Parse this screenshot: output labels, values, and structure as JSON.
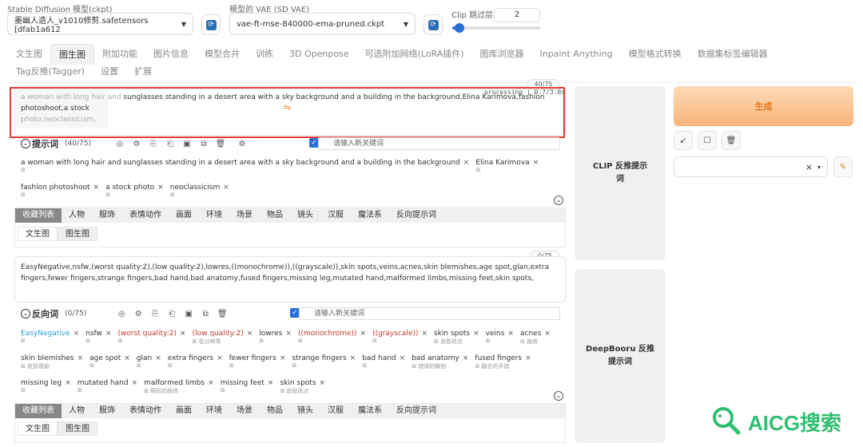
{
  "header": {
    "model_label": "Stable Diffusion 模型(ckpt)",
    "model_value": "墨幽人造人_v1010修剪.safetensors [dfab1a612",
    "vae_label": "模型的 VAE (SD VAE)",
    "vae_value": "vae-ft-mse-840000-ema-pruned.ckpt",
    "clip_label": "Clip 跳过层",
    "clip_value": "2",
    "clip_slider_fraction": 0.08
  },
  "tabs": [
    "文生图",
    "图生图",
    "附加功能",
    "图片信息",
    "模型合并",
    "训练",
    "3D Openpose",
    "可选附加网络(LoRA插件)",
    "图库浏览器",
    "Inpaint Anything",
    "模型格式转换",
    "数据集标签编辑器"
  ],
  "tabs2": [
    "Tag反推(Tagger)",
    "设置",
    "扩展"
  ],
  "active_tab": "图生图",
  "prompt": {
    "counter": "40/75",
    "processing": "processing | 0.7/3.8s",
    "text_left": "a woman with long hair and",
    "text_main": " sunglasses standing in a desert area with a sky background and a building in the background,Elina Karimova,fashion photoshoot,a stock",
    "text_line2": "photo,neoclassicism,",
    "title": "提示词",
    "count": "(40/75)",
    "keyword_placeholder": "请输入新关键词",
    "tags": [
      {
        "t": "a woman with long hair and sunglasses standing in a desert area with a sky background and a building in the background",
        "s": ""
      },
      {
        "t": "Elina Karimova",
        "s": ""
      },
      {
        "t": "fashion photoshoot",
        "s": ""
      },
      {
        "t": "a stock photo",
        "s": ""
      },
      {
        "t": "neoclassicism",
        "s": ""
      }
    ]
  },
  "categories": [
    "收藏列表",
    "人物",
    "服饰",
    "表情动作",
    "画面",
    "环境",
    "场景",
    "物品",
    "镜头",
    "汉服",
    "魔法系",
    "反向提示词"
  ],
  "subtabs": [
    "文生图",
    "图生图"
  ],
  "negative": {
    "counter": "0/75",
    "text": "EasyNegative,nsfw,(worst quality:2),(low quality:2),lowres,((monochrome)),((grayscale)),skin spots,veins,acnes,skin blemishes,age spot,glan,extra fingers,fewer fingers,strange fingers,bad hand,bad anatomy,fused fingers,missing leg,mutated hand,malformed limbs,missing feet,skin spots,",
    "title": "反向词",
    "count": "(0/75)",
    "keyword_placeholder": "请输入新关键词",
    "tags_row1": [
      {
        "t": "EasyNegative",
        "s": "",
        "c": "#2a9fd6"
      },
      {
        "t": "nsfw",
        "s": "",
        "c": "#333"
      },
      {
        "t": "(worst quality:2)",
        "s": "",
        "c": "#c0392b"
      },
      {
        "t": "(low quality:2)",
        "s": "低分辨率",
        "c": "#c0392b"
      },
      {
        "t": "lowres",
        "s": "",
        "c": "#333"
      },
      {
        "t": "((monochrome))",
        "s": "",
        "c": "#c0392b"
      },
      {
        "t": "((grayscale))",
        "s": "",
        "c": "#c0392b"
      },
      {
        "t": "skin spots",
        "s": "皮肤斑点",
        "c": "#333"
      },
      {
        "t": "veins",
        "s": "",
        "c": "#333"
      },
      {
        "t": "acnes",
        "s": "痤疮",
        "c": "#333"
      }
    ],
    "tags_row2": [
      {
        "t": "skin blemishes",
        "s": "皮肤瑕疵",
        "c": "#333"
      },
      {
        "t": "age spot",
        "s": "",
        "c": "#333"
      },
      {
        "t": "glan",
        "s": "",
        "c": "#333"
      },
      {
        "t": "extra fingers",
        "s": "",
        "c": "#333"
      },
      {
        "t": "fewer fingers",
        "s": "",
        "c": "#333"
      },
      {
        "t": "strange fingers",
        "s": "",
        "c": "#333"
      },
      {
        "t": "bad hand",
        "s": "",
        "c": "#333"
      },
      {
        "t": "bad anatomy",
        "s": "错误的解剖",
        "c": "#333"
      },
      {
        "t": "fused fingers",
        "s": "融合的手指",
        "c": "#333"
      }
    ],
    "tags_row3": [
      {
        "t": "missing leg",
        "s": "",
        "c": "#333"
      },
      {
        "t": "mutated hand",
        "s": "",
        "c": "#333"
      },
      {
        "t": "malformed limbs",
        "s": "畸形的肢体",
        "c": "#333"
      },
      {
        "t": "missing feet",
        "s": "",
        "c": "#333"
      },
      {
        "t": "skin spots",
        "s": "皮肤斑点",
        "c": "#333"
      }
    ]
  },
  "side": {
    "clip_btn": "CLIP 反推提示词",
    "deepbooru_btn": "DeepBooru 反推提示词",
    "generate": "生成"
  },
  "watermark": "AICG搜索",
  "colors": {
    "accent": "#f08a24",
    "highlight": "#e53935",
    "checkbox": "#2a6fd6"
  }
}
